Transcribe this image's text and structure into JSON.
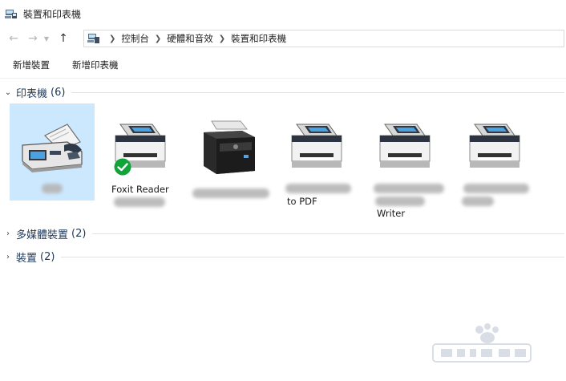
{
  "window": {
    "title": "裝置和印表機"
  },
  "address": {
    "crumbs": [
      "控制台",
      "硬體和音效",
      "裝置和印表機"
    ]
  },
  "commands": {
    "add_device": "新增裝置",
    "add_printer": "新增印表機"
  },
  "groups": {
    "printers": {
      "title": "印表機",
      "count": "(6)",
      "expanded": true
    },
    "multimedia": {
      "title": "多媒體裝置",
      "count": "(2)",
      "expanded": false
    },
    "devices": {
      "title": "裝置",
      "count": "(2)",
      "expanded": false
    }
  },
  "printers": [
    {
      "kind": "fax",
      "label": "",
      "selected": true,
      "default": false
    },
    {
      "kind": "printer",
      "label": "Foxit Reader",
      "selected": false,
      "default": true
    },
    {
      "kind": "laser-printer",
      "label": "",
      "selected": false,
      "default": false
    },
    {
      "kind": "printer",
      "label": "to PDF",
      "selected": false,
      "default": false
    },
    {
      "kind": "printer",
      "label": "Writer",
      "selected": false,
      "default": false
    },
    {
      "kind": "printer",
      "label": "",
      "selected": false,
      "default": false
    }
  ],
  "colors": {
    "accent": "#1e395b",
    "selection": "#cce8ff",
    "default_badge": "#12a33a"
  }
}
